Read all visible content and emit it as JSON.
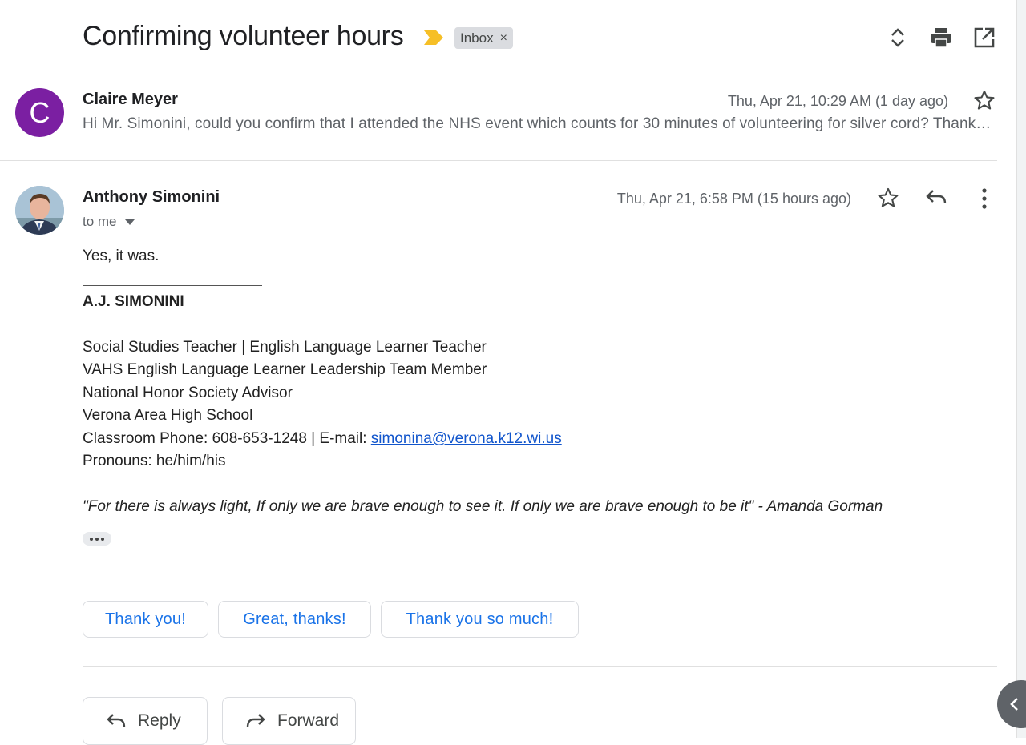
{
  "thread": {
    "subject": "Confirming volunteer hours",
    "label": "Inbox",
    "label_remove": "×"
  },
  "colors": {
    "importance_marker": "#f6bf26",
    "avatar_c_bg": "#7b1fa2",
    "link": "#1155cc",
    "smart_reply_text": "#1a73e8"
  },
  "icons": {
    "toolbar": [
      "expand-collapse-icon",
      "print-icon",
      "open-in-new-window-icon"
    ],
    "message_1": [
      "star-icon"
    ],
    "message_2": [
      "star-icon",
      "reply-icon",
      "more-vert-icon"
    ]
  },
  "message_1": {
    "avatar_letter": "C",
    "sender": "Claire Meyer",
    "date": "Thu, Apr 21, 10:29 AM (1 day ago)",
    "snippet": "Hi Mr. Simonini, could you confirm that I attended the NHS event which counts for 30 minutes of volunteering for silver cord? Thank you!"
  },
  "message_2": {
    "sender": "Anthony Simonini",
    "date": "Thu, Apr 21, 6:58 PM (15 hours ago)",
    "recipient": "to me",
    "body": "Yes, it was.",
    "signature": {
      "name": "A.J. SIMONINI",
      "lines": [
        "Social Studies Teacher | English Language Learner Teacher",
        "VAHS English Language Learner Leadership Team Member",
        "National Honor Society Advisor",
        "Verona Area High School"
      ],
      "phone_prefix": "Classroom Phone: 608-653-1248 | E-mail: ",
      "email": "simonina@verona.k12.wi.us",
      "pronouns": "Pronouns: he/him/his",
      "quote": "\"For there is always light, If only we are brave enough to see it. If only we are brave enough to be it\" - Amanda Gorman"
    }
  },
  "smart_replies": [
    "Thank you!",
    "Great, thanks!",
    "Thank you so much!"
  ],
  "actions": {
    "reply": "Reply",
    "forward": "Forward"
  }
}
